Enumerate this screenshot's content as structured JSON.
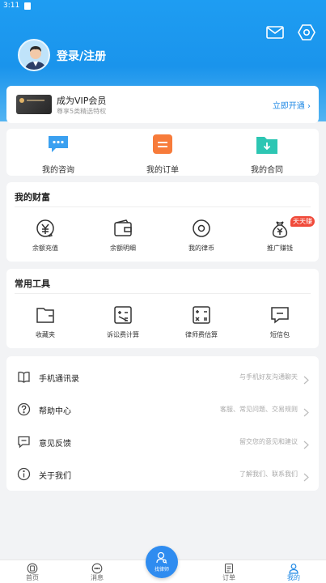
{
  "status_bar": {
    "time": "3:11"
  },
  "header": {
    "login_text": "登录/注册"
  },
  "vip": {
    "title": "成为VIP会员",
    "subtitle": "尊享5类精选特权",
    "link": "立即开通 ›"
  },
  "quick_actions": [
    {
      "label": "我的咨询",
      "icon": "chat-bubble-icon"
    },
    {
      "label": "我的订单",
      "icon": "order-list-icon"
    },
    {
      "label": "我的合同",
      "icon": "contract-folder-icon"
    }
  ],
  "wealth": {
    "title": "我的财富",
    "items": [
      {
        "label": "余额充值",
        "icon": "yuan-coin-icon"
      },
      {
        "label": "余额明细",
        "icon": "wallet-icon"
      },
      {
        "label": "我的律币",
        "icon": "coin-target-icon"
      },
      {
        "label": "推广赚钱",
        "icon": "money-bag-icon",
        "badge": "天天赚"
      }
    ]
  },
  "tools": {
    "title": "常用工具",
    "items": [
      {
        "label": "收藏夹",
        "icon": "folder-icon"
      },
      {
        "label": "诉讼费计算",
        "icon": "calculator-icon"
      },
      {
        "label": "律师费估算",
        "icon": "math-calculator-icon"
      },
      {
        "label": "短信包",
        "icon": "sms-icon"
      }
    ]
  },
  "menu": [
    {
      "title": "手机通讯录",
      "desc": "与手机好友沟通聊天",
      "icon": "contacts-book-icon"
    },
    {
      "title": "帮助中心",
      "desc": "客服、常见问题、交易规则",
      "icon": "help-circle-icon"
    },
    {
      "title": "意见反馈",
      "desc": "留交您的意见和建议",
      "icon": "feedback-icon"
    },
    {
      "title": "关于我们",
      "desc": "了解我们、联系我们",
      "icon": "info-circle-icon"
    }
  ],
  "bottom_nav": {
    "items": [
      {
        "label": "首页",
        "icon": "home-icon"
      },
      {
        "label": "消息",
        "icon": "message-icon"
      },
      {
        "label": "订单",
        "icon": "order-icon"
      },
      {
        "label": "我的",
        "icon": "profile-icon"
      }
    ],
    "fab_label": "找律师",
    "active": "我的"
  },
  "colors": {
    "primary": "#1e88e5",
    "header_blue": "#1e9df2",
    "badge_red": "#f04a3a"
  }
}
